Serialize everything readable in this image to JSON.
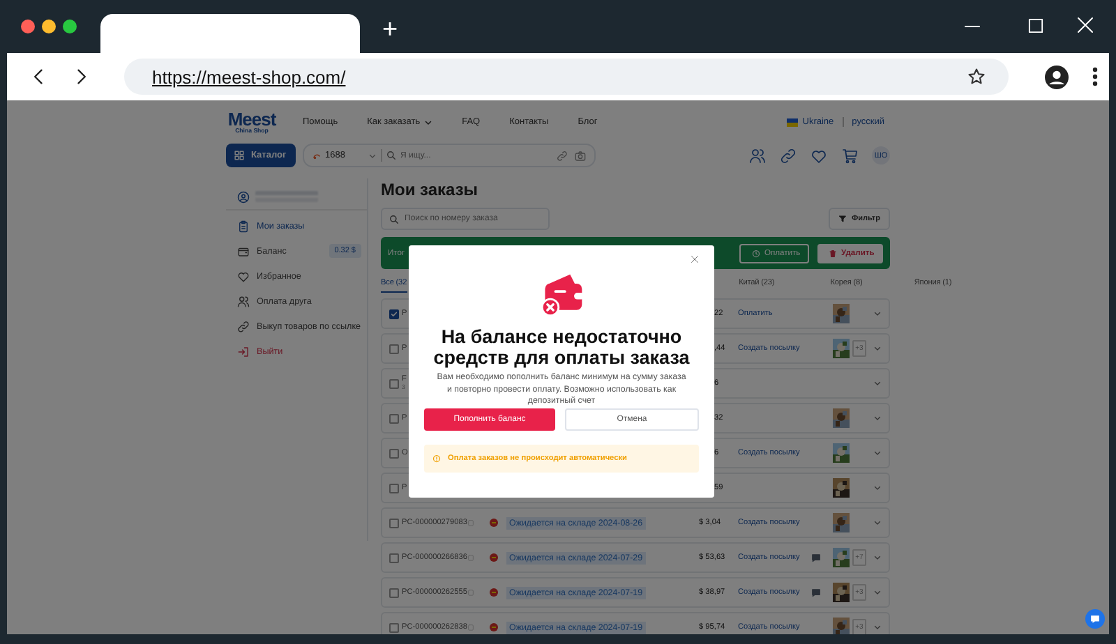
{
  "browser": {
    "new_tab": "+",
    "url": "https://meest-shop.com/"
  },
  "header": {
    "logo": "Meest",
    "logo_sub": "China Shop",
    "nav": [
      {
        "label": "Помощь",
        "kind": "link"
      },
      {
        "label": "Как заказать",
        "kind": "dropdown"
      },
      {
        "label": "FAQ",
        "kind": "link"
      },
      {
        "label": "Контакты",
        "kind": "link"
      },
      {
        "label": "Блог",
        "kind": "link"
      }
    ],
    "country": "Ukraine",
    "language": "русский",
    "catalog_button": "Каталог",
    "source": "1688",
    "search": {
      "placeholder": "Я ищу..."
    },
    "avatar": "ШО"
  },
  "sidebar": {
    "items": [
      {
        "kind": "orders",
        "label": "Мои заказы",
        "selected": true
      },
      {
        "kind": "balance",
        "label": "Баланс",
        "badge": "0.32 $",
        "selected": false
      },
      {
        "kind": "favorites",
        "label": "Избранное",
        "selected": false
      },
      {
        "kind": "friend",
        "label": "Оплата друга",
        "selected": false
      },
      {
        "kind": "link",
        "label": "Выкуп товаров по ссылке",
        "selected": false
      },
      {
        "kind": "logout",
        "label": "Выйти",
        "selected": false
      }
    ]
  },
  "main": {
    "title": "Мои заказы",
    "search": {
      "placeholder": "Поиск по номеру заказа"
    },
    "filter_button": "Фильтр",
    "summary": {
      "label": "Итог",
      "pay_button": "Оплатить",
      "delete_button": "Удалить"
    },
    "tabs": [
      {
        "label": "Все (32",
        "selected": true
      },
      {
        "label": "Китай (23)",
        "selected": false
      },
      {
        "label": "Корея (8)",
        "selected": false
      },
      {
        "label": "Япония (1)",
        "selected": false
      }
    ],
    "rows": [
      {
        "kind": "partial",
        "checked": true,
        "order": "P",
        "amount": "22",
        "action": "Оплатить",
        "comment": false,
        "thumbnail": true
      },
      {
        "kind": "partial",
        "checked": false,
        "order": "P",
        "amount": ",44",
        "action": "Создать посылку",
        "comment": false,
        "thumbnail": true,
        "more": "+3"
      },
      {
        "kind": "partial",
        "checked": false,
        "order": "F",
        "note": "3",
        "amount": "6",
        "comment": false,
        "thumbnail": false
      },
      {
        "kind": "partial",
        "checked": false,
        "order": "P",
        "amount": "32",
        "comment": false,
        "thumbnail": true
      },
      {
        "kind": "partial",
        "checked": false,
        "order": "O",
        "amount": "6",
        "action": "Создать посылку",
        "comment": false,
        "thumbnail": true
      },
      {
        "kind": "partial",
        "checked": false,
        "order": "P",
        "amount": "59",
        "comment": false,
        "thumbnail": true
      },
      {
        "kind": "full",
        "checked": false,
        "order": "PC-000000279083",
        "status": "Ожидается на складе 2024-08-26",
        "amount": "$ 3,04",
        "action": "Создать посылку",
        "comment": false,
        "thumbnail": true
      },
      {
        "kind": "full",
        "checked": false,
        "order": "PC-000000266836",
        "status": "Ожидается на складе 2024-07-29",
        "amount": "$ 53,63",
        "action": "Создать посылку",
        "comment": true,
        "thumbnail": true,
        "more": "+7"
      },
      {
        "kind": "full",
        "checked": false,
        "order": "PC-000000262555",
        "status": "Ожидается на складе 2024-07-19",
        "amount": "$ 38,97",
        "action": "Создать посылку",
        "comment": true,
        "thumbnail": true,
        "more": "+3"
      },
      {
        "kind": "full",
        "checked": false,
        "order": "PC-000000262838",
        "status": "Ожидается на складе 2024-07-19",
        "amount": "$ 95,74",
        "action": "Создать посылку",
        "comment": false,
        "thumbnail": true,
        "more": "+3"
      }
    ]
  },
  "modal": {
    "title": "На балансе недостаточно средств для оплаты заказа",
    "text": "Вам необходимо пополнить баланс минимум на сумму заказа и повторно провести оплату. Возможно использовать как депозитный счет",
    "confirm_button": "Пополнить баланс",
    "cancel_button": "Отмена",
    "notice": "Оплата заказов не происходит автоматически"
  }
}
